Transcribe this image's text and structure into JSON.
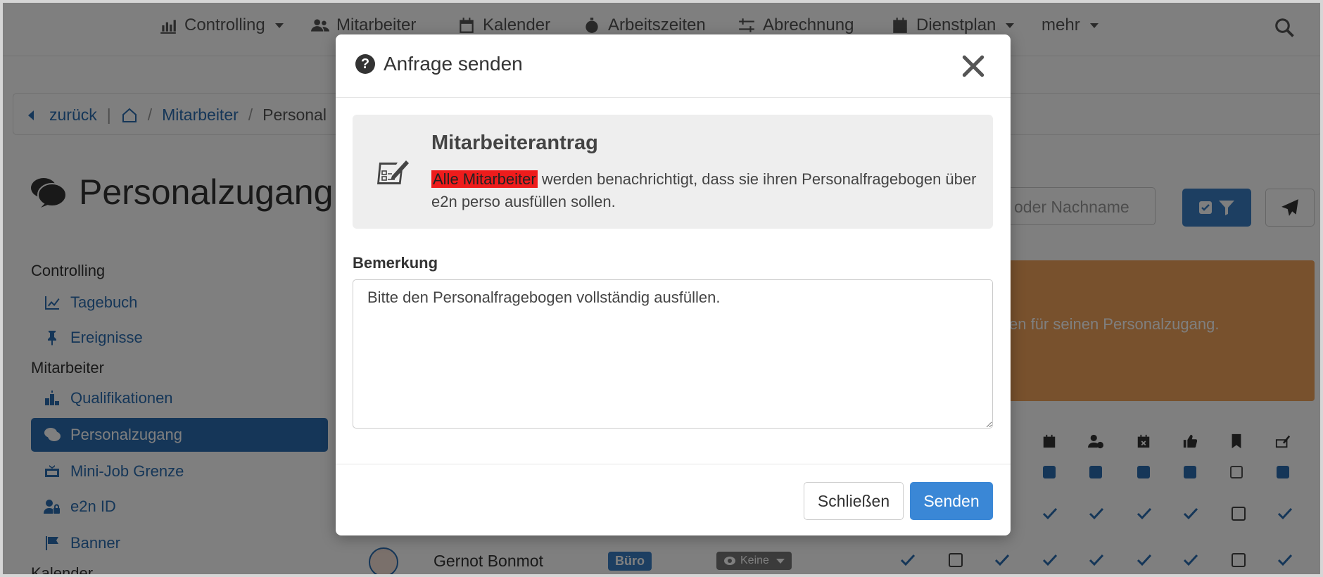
{
  "nav": {
    "items": [
      {
        "label": "Controlling",
        "icon": "chart-icon",
        "dropdown": true
      },
      {
        "label": "Mitarbeiter",
        "icon": "users-icon",
        "dropdown": false
      },
      {
        "label": "Kalender",
        "icon": "calendar-icon",
        "dropdown": false
      },
      {
        "label": "Arbeitszeiten",
        "icon": "stopwatch-icon",
        "dropdown": false
      },
      {
        "label": "Abrechnung",
        "icon": "sliders-icon",
        "dropdown": false
      },
      {
        "label": "Dienstplan",
        "icon": "calendar-grid-icon",
        "dropdown": true
      },
      {
        "label": "mehr",
        "icon": "",
        "dropdown": true
      }
    ]
  },
  "breadcrumb": {
    "back": "zurück",
    "pipe": "|",
    "separator": "/",
    "items": [
      "Mitarbeiter",
      "Personal"
    ]
  },
  "page": {
    "title": "Personalzugang"
  },
  "sidebar": {
    "sections": [
      {
        "heading": "Controlling",
        "items": [
          {
            "label": "Tagebuch",
            "icon": "line-chart-icon"
          },
          {
            "label": "Ereignisse",
            "icon": "pin-icon"
          }
        ]
      },
      {
        "heading": "Mitarbeiter",
        "items": [
          {
            "label": "Qualifikationen",
            "icon": "podium-icon"
          },
          {
            "label": "Personalzugang",
            "icon": "chat-bubbles-icon",
            "active": true
          },
          {
            "label": "Mini-Job Grenze",
            "icon": "money-icon"
          },
          {
            "label": "e2n ID",
            "icon": "user-lock-icon"
          },
          {
            "label": "Banner",
            "icon": "flag-icon"
          }
        ]
      },
      {
        "heading": "Kalender",
        "items": []
      }
    ]
  },
  "toolbar": {
    "search_placeholder": "oder Nachname"
  },
  "alert": {
    "text": "en für seinen Personalzugang."
  },
  "table": {
    "row": {
      "name": "Gernot Bonmot",
      "badge": "Büro",
      "visibility": "Keine"
    }
  },
  "modal": {
    "title": "Anfrage senden",
    "info_title": "Mitarbeiterantrag",
    "info_highlight": "Alle Mitarbeiter",
    "info_text": " werden benachrichtigt, dass sie ihren Personalfragebogen über e2n perso ausfüllen sollen.",
    "remark_label": "Bemerkung",
    "remark_value": "Bitte den Personalfragebogen vollständig ausfüllen.",
    "close_label": "Schließen",
    "send_label": "Senden"
  },
  "colors": {
    "primary": "#2a6db0",
    "button_primary": "#3a87d6",
    "alert_orange": "#f0a35b",
    "highlight_red": "#ee1c1c"
  }
}
